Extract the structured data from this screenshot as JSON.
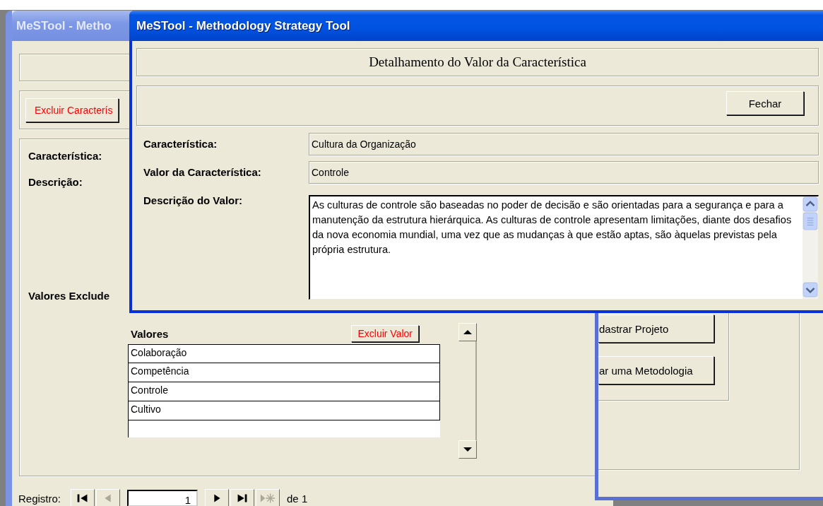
{
  "back_window": {
    "title": "MeSTool - Metho",
    "active": false,
    "delete_characteristic_button": "Excluir Caracterís",
    "labels": [
      "Característica:",
      "Descrição:",
      "Valores Exclude"
    ],
    "values_subform": {
      "heading": "Valores",
      "delete_button": "Excluir Valor",
      "rows": [
        "Colaboração",
        "Competência",
        "Controle",
        "Cultivo"
      ]
    },
    "record_navigator": {
      "label": "Registro:",
      "current": "1",
      "total": "de 1",
      "buttons": [
        {
          "kind": "first",
          "disabled": false
        },
        {
          "kind": "previous",
          "disabled": true
        },
        {
          "kind": "next",
          "disabled": false
        },
        {
          "kind": "last",
          "disabled": false
        },
        {
          "kind": "new",
          "disabled": true
        }
      ]
    }
  },
  "side_window": {
    "active": false,
    "buttons": [
      "dastrar Projeto",
      "ar uma Metodologia"
    ]
  },
  "front_window": {
    "title": "MeSTool - Methodology Strategy Tool",
    "active": true,
    "heading": "Detalhamento do Valor da Característica",
    "close_button": "Fechar",
    "fields": [
      {
        "kind": "text",
        "label": "Característica:",
        "value": "Cultura da Organização"
      },
      {
        "kind": "text",
        "label": "Valor da Característica:",
        "value": "Controle"
      },
      {
        "kind": "memo",
        "label": "Descrição do Valor:",
        "value": "As culturas de controle são baseadas no poder de decisão e são orientadas para a segurança e para a manutenção da estrutura hierárquica. As culturas de controle apresentam limitações, diante dos desafios da nova economia mundial, uma vez que as mudanças à que estão aptas, são àquelas previstas pela própria estrutura."
      }
    ]
  }
}
